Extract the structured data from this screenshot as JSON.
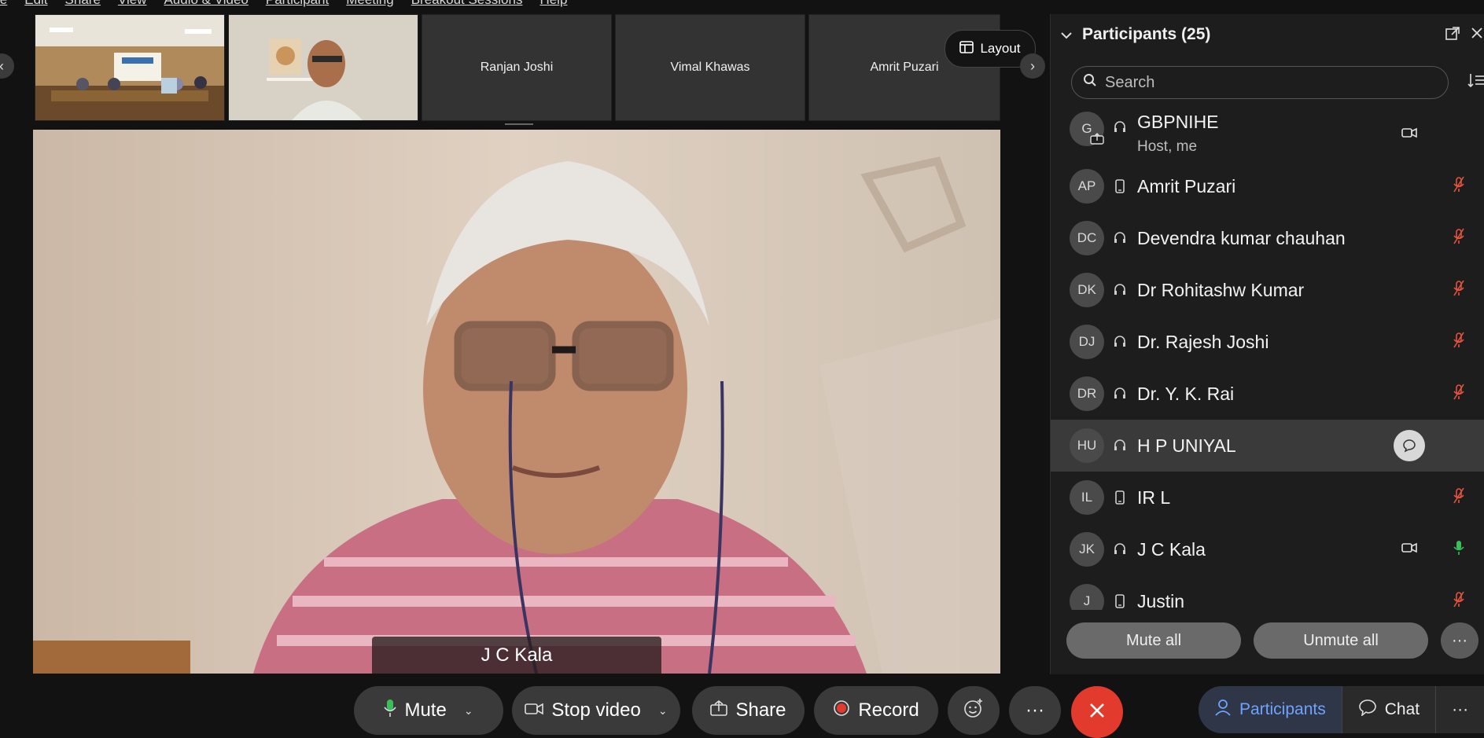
{
  "menu": [
    "le",
    "Edit",
    "Share",
    "View",
    "Audio & Video",
    "Participant",
    "Meeting",
    "Breakout Sessions",
    "Help"
  ],
  "filmstrip": {
    "tiles": [
      {
        "name": ""
      },
      {
        "name": ""
      },
      {
        "name": "Ranjan Joshi"
      },
      {
        "name": "Vimal Khawas"
      },
      {
        "name": "Amrit Puzari"
      }
    ],
    "layout_label": "Layout"
  },
  "main_video": {
    "speaker_name": "J C Kala"
  },
  "panel": {
    "title": "Participants (25)",
    "search_placeholder": "Search",
    "participants": [
      {
        "initials": "G",
        "name": "GBPNIHE",
        "subtitle": "Host, me",
        "device": "headset",
        "video": true,
        "mic": "none"
      },
      {
        "initials": "AP",
        "name": "Amrit Puzari",
        "device": "phone",
        "video": false,
        "mic": "muted"
      },
      {
        "initials": "DC",
        "name": "Devendra kumar chauhan",
        "device": "headset",
        "video": false,
        "mic": "muted"
      },
      {
        "initials": "DK",
        "name": "Dr Rohitashw Kumar",
        "device": "headset",
        "video": false,
        "mic": "muted"
      },
      {
        "initials": "DJ",
        "name": "Dr. Rajesh Joshi",
        "device": "headset",
        "video": false,
        "mic": "muted"
      },
      {
        "initials": "DR",
        "name": "Dr. Y. K. Rai",
        "device": "headset",
        "video": false,
        "mic": "muted"
      },
      {
        "initials": "HU",
        "name": "H P UNIYAL",
        "device": "headset",
        "video": false,
        "mic": "chat",
        "highlighted": true
      },
      {
        "initials": "IL",
        "name": "IR L",
        "device": "phone",
        "video": false,
        "mic": "muted"
      },
      {
        "initials": "JK",
        "name": "J C Kala",
        "device": "headset",
        "video": true,
        "mic": "active"
      },
      {
        "initials": "J",
        "name": "Justin",
        "device": "phone",
        "video": false,
        "mic": "muted"
      }
    ],
    "mute_all": "Mute all",
    "unmute_all": "Unmute all"
  },
  "toolbar": {
    "mute": "Mute",
    "stop_video": "Stop video",
    "share": "Share",
    "record": "Record",
    "more": "···"
  },
  "bottom_right": {
    "participants": "Participants",
    "chat": "Chat"
  },
  "colors": {
    "accent_blue": "#6ea3ff",
    "end_red": "#e23a2c",
    "muted_red": "#e5533d",
    "active_green": "#3bbf5a",
    "record_red": "#e5392f"
  }
}
